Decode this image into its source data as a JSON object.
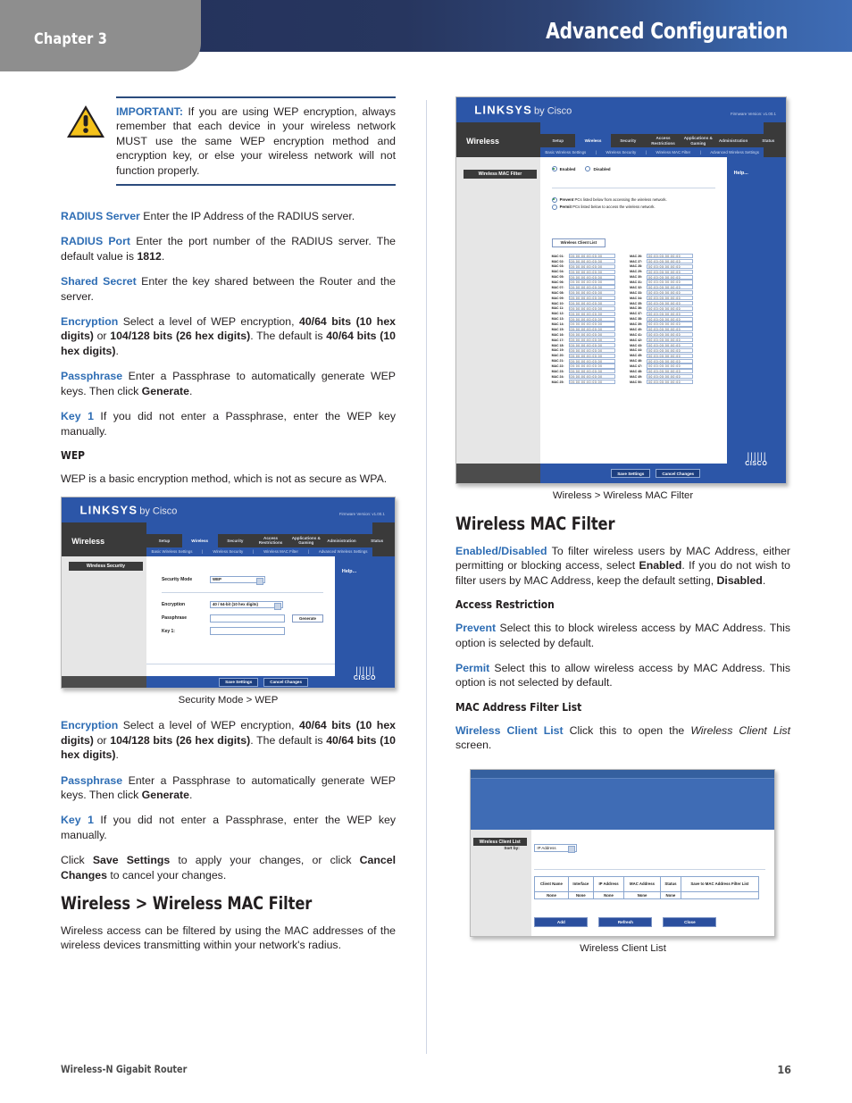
{
  "header": {
    "chapter": "Chapter 3",
    "title": "Advanced Configuration"
  },
  "footer": {
    "doc_title": "Wireless-N Gigabit Router",
    "page_number": "16"
  },
  "callout": {
    "label": "IMPORTANT:",
    "text": " If you are using WEP encryption, always remember that each device in your wireless network MUST use the same WEP encryption method and encryption key, or else your wireless network will not function properly.",
    "icon": "warning-triangle-icon"
  },
  "left_column": {
    "paragraphs": [
      {
        "term": "RADIUS Server",
        "text": " Enter the IP Address of the RADIUS server."
      },
      {
        "term": "RADIUS Port",
        "text": "  Enter the port number of the RADIUS server. The default value is ",
        "bold_tail": "1812",
        "tail": "."
      },
      {
        "term": "Shared Secret",
        "text": "  Enter the key shared between the Router and the server."
      }
    ],
    "encryption": {
      "term": "Encryption",
      "t1": " Select a level of WEP encryption, ",
      "b1": "40/64 bits (10 hex digits)",
      "t2": " or ",
      "b2": "104/128 bits (26 hex digits)",
      "t3": ". The default is ",
      "b3": "40/64 bits (10 hex digits)",
      "t4": "."
    },
    "passphrase": {
      "term": "Passphrase",
      "t1": "  Enter a Passphrase to automatically generate WEP keys. Then click ",
      "b1": "Generate",
      "t2": "."
    },
    "key1": {
      "term": "Key 1",
      "t1": "  If you did not enter a Passphrase, enter the WEP key manually."
    },
    "wep_head": "WEP",
    "wep_text": "WEP is a basic encryption method, which is not as secure as WPA.",
    "save_paragraph": {
      "t1": "Click ",
      "b1": "Save Settings",
      "t2": " to apply your changes, or click ",
      "b2": "Cancel Changes",
      "t3": " to cancel your changes."
    },
    "section_head": "Wireless > Wireless MAC Filter",
    "section_text": "Wireless access can be filtered by using the MAC addresses of the wireless devices transmitting within your network's radius."
  },
  "right_column": {
    "section_head": "Wireless MAC Filter",
    "enabled_disabled": {
      "term": "Enabled/Disabled",
      "t1": "  To filter wireless users by MAC Address, either permitting or blocking access, select ",
      "b1": "Enabled",
      "t2": ". If you do not wish to filter users by MAC Address, keep the default setting, ",
      "b2": "Disabled",
      "t3": "."
    },
    "access_restriction_head": "Access Restriction",
    "prevent": {
      "term": "Prevent",
      "t1": " Select this to block wireless access by MAC Address. This option is selected by default."
    },
    "permit": {
      "term": "Permit",
      "t1": " Select this to allow wireless access by MAC Address. This option is not selected by default."
    },
    "mac_filter_list_head": "MAC Address Filter List",
    "wireless_client_list": {
      "term": "Wireless Client List",
      "t1": "  Click this to open the ",
      "i1": "Wireless Client List",
      "t2": " screen."
    }
  },
  "figures": {
    "wep": {
      "caption": "Security Mode > WEP",
      "logo": "LINKSYS",
      "logo_suffix": "by Cisco",
      "firmware": "Firmware Version: v1.00.1",
      "module": "Wireless",
      "tabs": [
        "Setup",
        "Wireless",
        "Security",
        "Access Restrictions",
        "Applications & Gaming",
        "Administration",
        "Status"
      ],
      "active_tab": "Wireless",
      "subtabs": [
        "Basic Wireless Settings",
        "Wireless Security",
        "Wireless MAC Filter",
        "Advanced Wireless Settings"
      ],
      "page_title": "Wireless Security",
      "help_label": "Help...",
      "fields": [
        {
          "label": "Security Mode",
          "type": "select",
          "value": "WEP"
        },
        {
          "label": "Encryption",
          "type": "select",
          "value": "40 / 64-bit (10 hex digits)"
        },
        {
          "label": "Passphrase",
          "type": "text",
          "value": ""
        },
        {
          "label": "Key 1:",
          "type": "text",
          "value": ""
        }
      ],
      "generate_button": "Generate",
      "save_button": "Save Settings",
      "cancel_button": "Cancel Changes",
      "cisco_word": "CISCO"
    },
    "macfilter": {
      "caption": "Wireless > Wireless MAC Filter",
      "logo": "LINKSYS",
      "logo_suffix": "by Cisco",
      "firmware": "Firmware Version: v1.00.1",
      "module": "Wireless",
      "tabs": [
        "Setup",
        "Wireless",
        "Security",
        "Access Restrictions",
        "Applications & Gaming",
        "Administration",
        "Status"
      ],
      "active_tab": "Wireless",
      "subtabs": [
        "Basic Wireless Settings",
        "Wireless Security",
        "Wireless MAC Filter",
        "Advanced Wireless Settings"
      ],
      "page_title": "Wireless MAC Filter",
      "help_label": "Help...",
      "enable_radio": {
        "on_label": "Enabled",
        "off_label": "Disabled",
        "selected": "Enabled"
      },
      "restriction_options": [
        {
          "label_bold": "Prevent",
          "label_rest": " PCs listed below from accessing the wireless network.",
          "selected": true
        },
        {
          "label_bold": "Permit",
          "label_rest": " PCs listed below to access the wireless network.",
          "selected": false
        }
      ],
      "client_list_button": "Wireless Client List",
      "mac_prefix": "MAC ",
      "mac_placeholder_left": "00:00:00:00:00:00",
      "mac_placeholder_right": "00:00:00:00:00:00",
      "mac_count_per_column": 25,
      "save_button": "Save Settings",
      "cancel_button": "Cancel Changes",
      "cisco_word": "CISCO"
    },
    "clientlist": {
      "caption": "Wireless Client List",
      "page_title": "Wireless Client List",
      "sort_label": "Sort by:",
      "sort_value": "IP Address",
      "columns": [
        "Client Name",
        "Interface",
        "IP Address",
        "MAC Address",
        "Status",
        "Save to MAC Address Filter List"
      ],
      "row": [
        "None",
        "None",
        "None",
        "None",
        "None",
        ""
      ],
      "buttons": [
        "Add",
        "Refresh",
        "Close"
      ]
    }
  },
  "colors": {
    "accent_blue": "#2e6db4",
    "header_dark": "#24325c",
    "header_light": "#3f6cb5",
    "chapter_gray": "#8e8e8e",
    "warning_yellow": "#f5c21b",
    "ui_blue": "#2c56a8",
    "text": "#231f20"
  }
}
